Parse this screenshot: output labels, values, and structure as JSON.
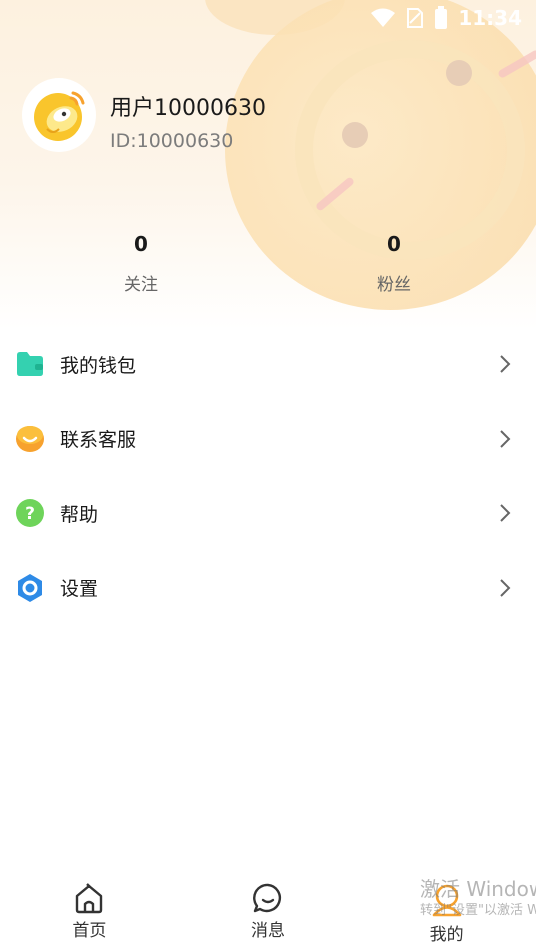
{
  "status_bar": {
    "time": "11:34"
  },
  "profile": {
    "name": "用户10000630",
    "id_text": "ID:10000630",
    "stats": [
      {
        "value": "0",
        "label": "关注"
      },
      {
        "value": "0",
        "label": "粉丝"
      }
    ]
  },
  "menu": {
    "items": [
      {
        "label": "我的钱包",
        "icon": "wallet-icon",
        "color": "#34d1b0"
      },
      {
        "label": "联系客服",
        "icon": "customer-service-icon",
        "color": "#f7a22e"
      },
      {
        "label": "帮助",
        "icon": "help-icon",
        "color": "#6ed45a"
      },
      {
        "label": "设置",
        "icon": "settings-icon",
        "color": "#2e8ae6"
      }
    ]
  },
  "tabbar": {
    "tabs": [
      {
        "label": "首页",
        "icon": "home-icon",
        "active": false
      },
      {
        "label": "消息",
        "icon": "message-icon",
        "active": false
      },
      {
        "label": "我的",
        "icon": "profile-icon",
        "active": true,
        "color": "#f7a22e"
      }
    ]
  },
  "watermark": {
    "title": "激活 Windows",
    "subtitle": "转到\"设置\"以激活 Windows。"
  }
}
